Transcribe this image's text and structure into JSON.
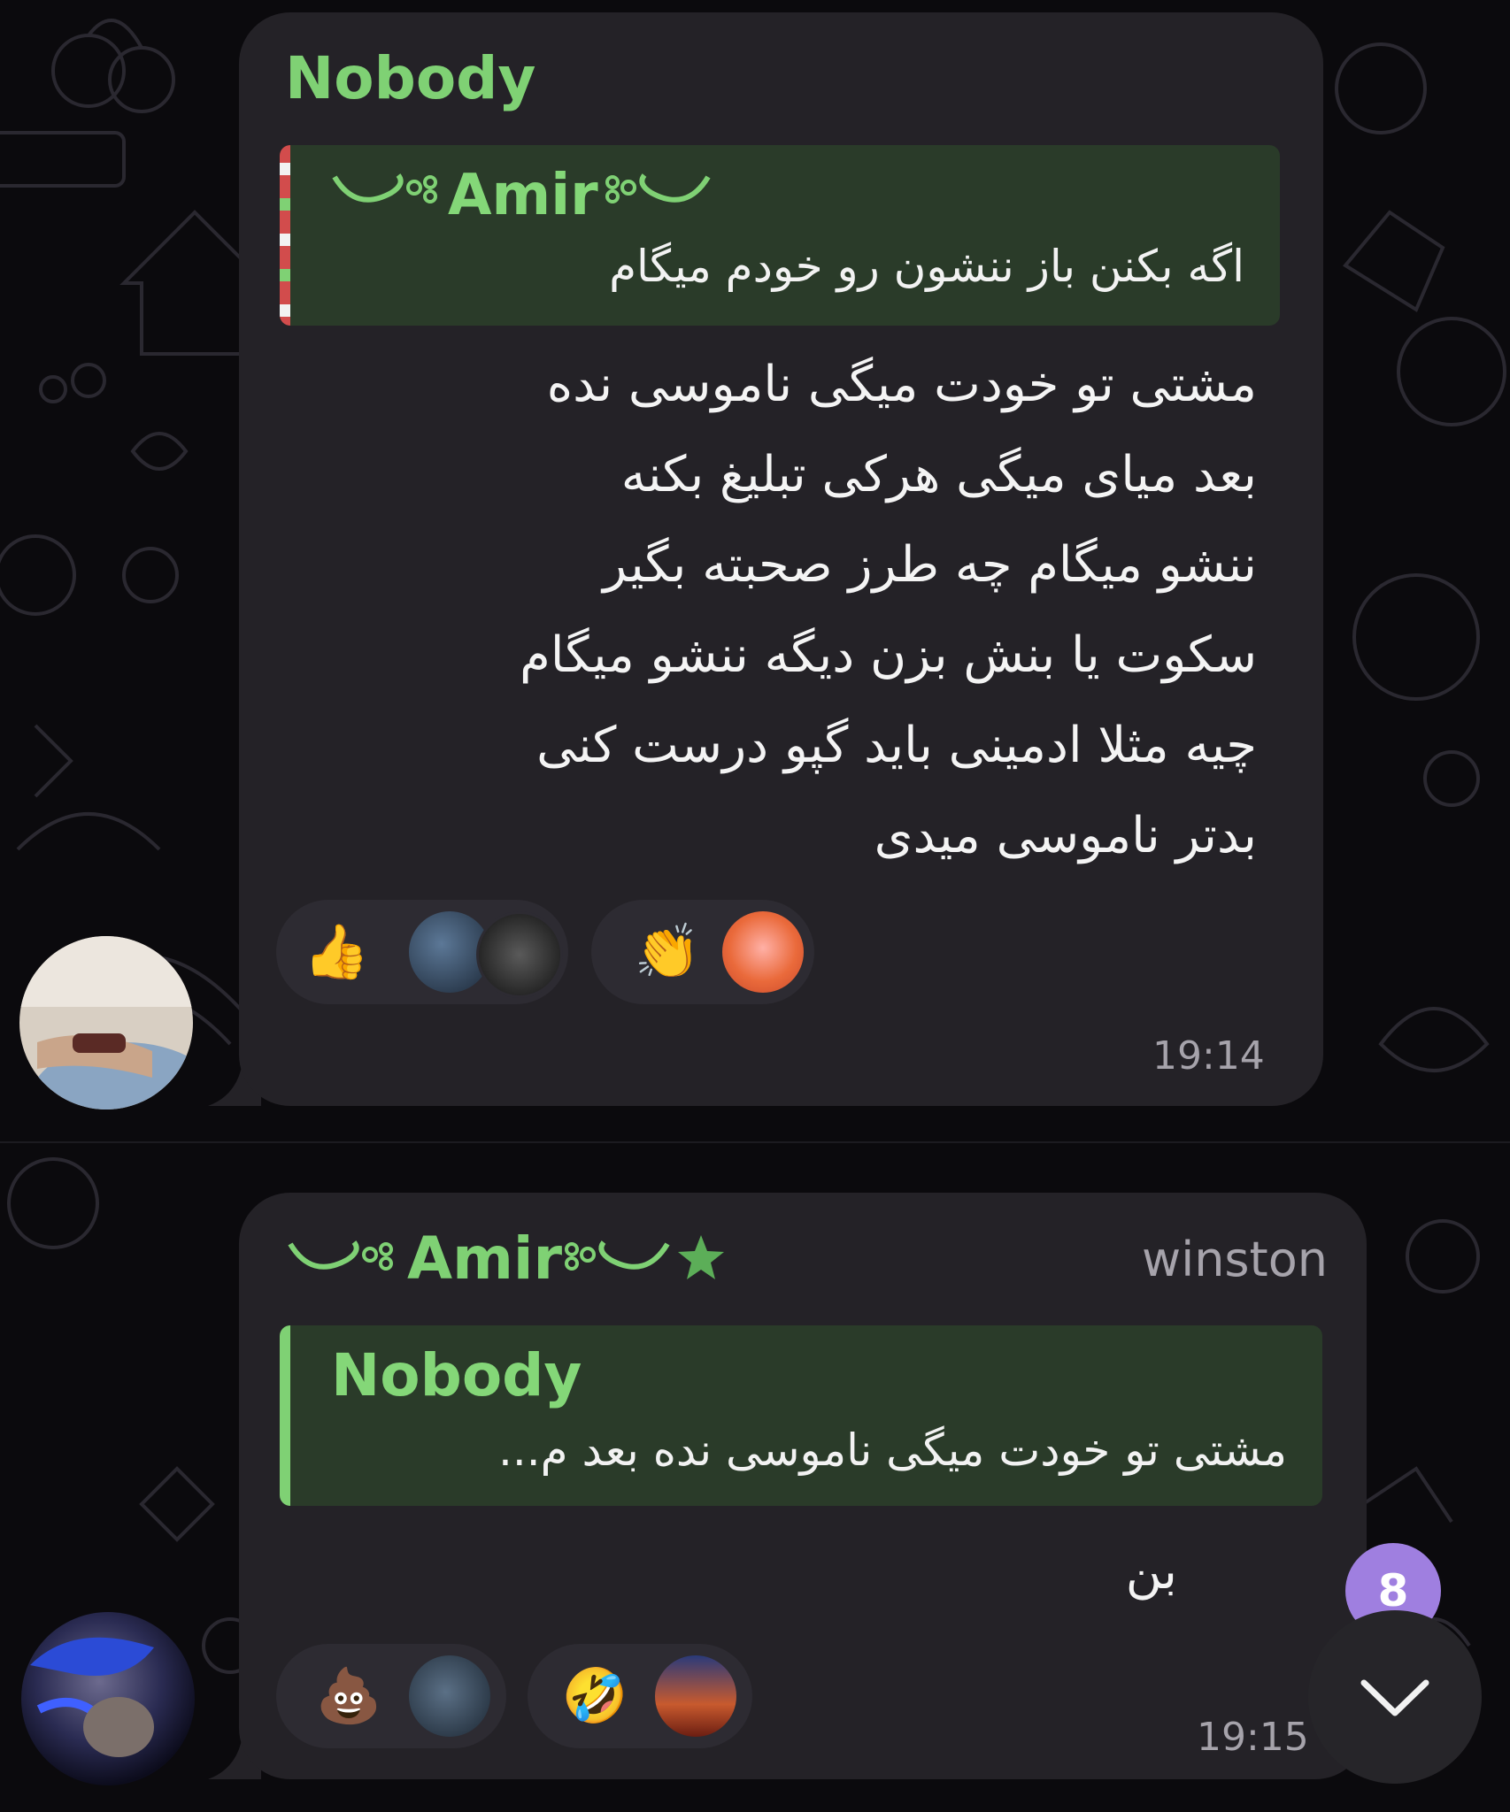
{
  "colors": {
    "background": "#0b0a0d",
    "bubble": "#242227",
    "accent_green": "#7fd174",
    "quote_bg": "#2a3b29",
    "badge": "#9f7fe0",
    "timestamp": "#a6a3ab"
  },
  "messages": [
    {
      "sender": "Nobody",
      "reply": {
        "name": "Amir",
        "text": "اگه بکنن باز ننشون رو خودم میگام"
      },
      "lines": [
        "مشتی تو خودت میگی ناموسی نده",
        "بعد میای میگی هرکی تبلیغ بکنه",
        "ننشو میگام چه طرز صحبته بگیر",
        "سکوت یا بنش بزن دیگه ننشو میگام",
        "چیه مثلا ادمینی باید گپو درست کنی",
        "بدتر ناموسی میدی"
      ],
      "reactions": [
        {
          "emoji": "👍",
          "icon": "thumbs-up-icon"
        },
        {
          "emoji": "👏",
          "icon": "clapping-hands-icon"
        }
      ],
      "time": "19:14"
    },
    {
      "sender": "Amir",
      "role": "winston",
      "reply": {
        "name": "Nobody",
        "text": "مشتی تو خودت میگی ناموسی نده بعد م..."
      },
      "lines": [
        "بن"
      ],
      "reactions": [
        {
          "emoji": "💩",
          "icon": "pile-of-poo-icon"
        },
        {
          "emoji": "🤣",
          "icon": "rolling-laughing-icon"
        }
      ],
      "time": "19:15"
    }
  ],
  "unread_count": "8"
}
